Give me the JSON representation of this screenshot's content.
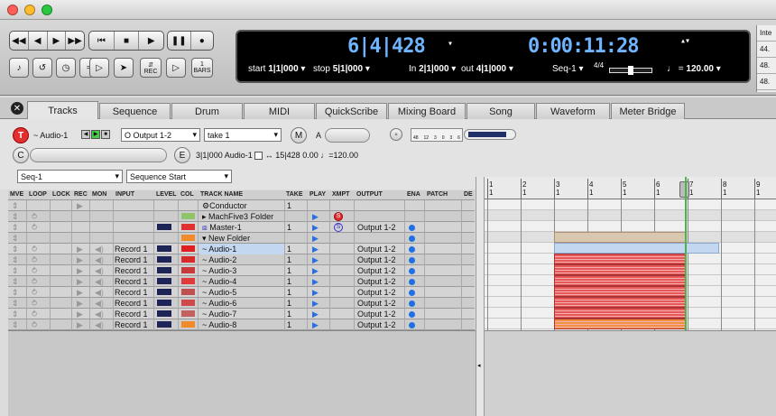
{
  "transport": {
    "counter_main": "6|4|428",
    "counter_sub": "0:00:11:28",
    "start_label": "start",
    "start_value": "1|1|000",
    "stop_label": "stop",
    "stop_value": "5|1|000",
    "in_label": "In",
    "in_value": "2|1|000",
    "out_label": "out",
    "out_value": "4|1|000",
    "sequence": "Seq-1",
    "meter": "4/4",
    "tempo_value": "120.00",
    "bars_label": "BARS",
    "rec_label": "REC",
    "bar_value": "1"
  },
  "side_panel": [
    "Inte",
    "44.",
    "48.",
    "48."
  ],
  "tabs": [
    "Tracks",
    "Sequence",
    "Drum",
    "MIDI",
    "QuickScribe",
    "Mixing Board",
    "Song",
    "Waveform",
    "Meter Bridge"
  ],
  "active_tab": "Tracks",
  "controls": {
    "track_name": "~ Audio-1",
    "output": "O Output 1-2",
    "take": "take 1",
    "m_label": "M",
    "a_label": "A",
    "c_label": "C",
    "e_label": "E",
    "position": "3|1|000",
    "audio_name": "Audio-1",
    "end_position": "15|428",
    "offset": "0.00",
    "tempo": "120.00",
    "seq_select": "Seq-1",
    "seq_start": "Sequence Start",
    "meter_scale": [
      "48",
      "12",
      "3",
      "0",
      "3",
      "6"
    ]
  },
  "columns": [
    "MVE",
    "LOOP",
    "LOCK",
    "REC",
    "MON",
    "INPUT",
    "LEVEL",
    "COL",
    "TRACK NAME",
    "TAKE",
    "PLAY",
    "XMPT",
    "OUTPUT",
    "ENA",
    "PATCH",
    "DE"
  ],
  "tracks": [
    {
      "name": "Conductor",
      "take": "1",
      "input": "",
      "output": "",
      "color": "",
      "icon": "conductor-icon"
    },
    {
      "name": "MachFive3 Folder",
      "take": "",
      "input": "",
      "output": "",
      "color": "#8fc46a",
      "icon": "folder-triangle-icon",
      "xmpt": "S"
    },
    {
      "name": "Master-1",
      "take": "1",
      "input": "",
      "output": "Output 1-2",
      "color": "#e03030",
      "icon": "master-icon",
      "xmpt": "S"
    },
    {
      "name": "New Folder",
      "take": "",
      "input": "",
      "output": "",
      "color": "#f08a2a",
      "icon": "folder-open-icon"
    },
    {
      "name": "~ Audio-1",
      "take": "1",
      "input": "Record 1",
      "output": "Output 1-2",
      "color": "#e02020",
      "selected": true
    },
    {
      "name": "~ Audio-2",
      "take": "1",
      "input": "Record 1",
      "output": "Output 1-2",
      "color": "#d82a2a"
    },
    {
      "name": "~ Audio-3",
      "take": "1",
      "input": "Record 1",
      "output": "Output 1-2",
      "color": "#c83a3a"
    },
    {
      "name": "~ Audio-4",
      "take": "1",
      "input": "Record 1",
      "output": "Output 1-2",
      "color": "#e03a3a"
    },
    {
      "name": "~ Audio-5",
      "take": "1",
      "input": "Record 1",
      "output": "Output 1-2",
      "color": "#c05050"
    },
    {
      "name": "~ Audio-6",
      "take": "1",
      "input": "Record 1",
      "output": "Output 1-2",
      "color": "#d04848"
    },
    {
      "name": "~ Audio-7",
      "take": "1",
      "input": "Record 1",
      "output": "Output 1-2",
      "color": "#c46060"
    },
    {
      "name": "~ Audio-8",
      "take": "1",
      "input": "Record 1",
      "output": "Output 1-2",
      "color": "#f08a2a"
    }
  ],
  "ruler": {
    "bars": [
      "1",
      "2",
      "3",
      "4",
      "5",
      "6",
      "7",
      "8",
      "9"
    ],
    "beat": "1"
  },
  "colors": {
    "lcd_blue": "#6fb4ff",
    "record_red": "#e03030",
    "selected_row": "#c4d7f0",
    "playhead": "#49b449",
    "region_red": "#e85858",
    "region_orange": "#f09040"
  }
}
